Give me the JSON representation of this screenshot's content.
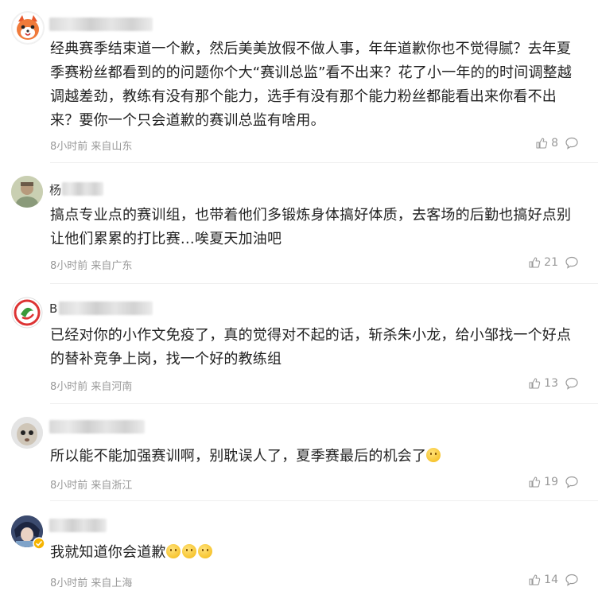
{
  "comments": [
    {
      "name_visible": "",
      "content": "经典赛季结束道一个歉，然后美美放假不做人事，年年道歉你也不觉得腻？去年夏季赛粉丝都看到的的问题你个大“赛训总监”看不出来？花了小一年的的时间调整越调越差劲，教练有没有那个能力，选手有没有那个能力粉丝都能看出来你看不出来？要你一个只会道歉的赛训总监有啥用。",
      "time": "8小时前",
      "location": "来自山东",
      "likes": "8",
      "avatar_icon": "cartoon-animal-avatar",
      "emoji_count": 0
    },
    {
      "name_visible": "杨",
      "content": "搞点专业点的赛训组，也带着他们多锻炼身体搞好体质，去客场的后勤也搞好点别让他们累累的打比赛…唉夏天加油吧",
      "time": "8小时前",
      "location": "来自广东",
      "likes": "21",
      "avatar_icon": "person-photo-avatar",
      "emoji_count": 0
    },
    {
      "name_visible": "B",
      "content": "已经对你的小作文免疫了，真的觉得对不起的话，斩杀朱小龙，给小邹找一个好点的替补竞争上岗，找一个好的教练组",
      "time": "8小时前",
      "location": "来自河南",
      "likes": "13",
      "avatar_icon": "team-logo-avatar",
      "emoji_count": 0
    },
    {
      "name_visible": "",
      "content": "所以能不能加强赛训啊，别耽误人了，夏季赛最后的机会了",
      "time": "8小时前",
      "location": "来自浙江",
      "likes": "19",
      "avatar_icon": "cartoon-face-avatar",
      "emoji_count": 1
    },
    {
      "name_visible": "",
      "content": "我就知道你会道歉",
      "time": "8小时前",
      "location": "来自上海",
      "likes": "14",
      "avatar_icon": "anime-character-avatar",
      "emoji_count": 3
    }
  ]
}
